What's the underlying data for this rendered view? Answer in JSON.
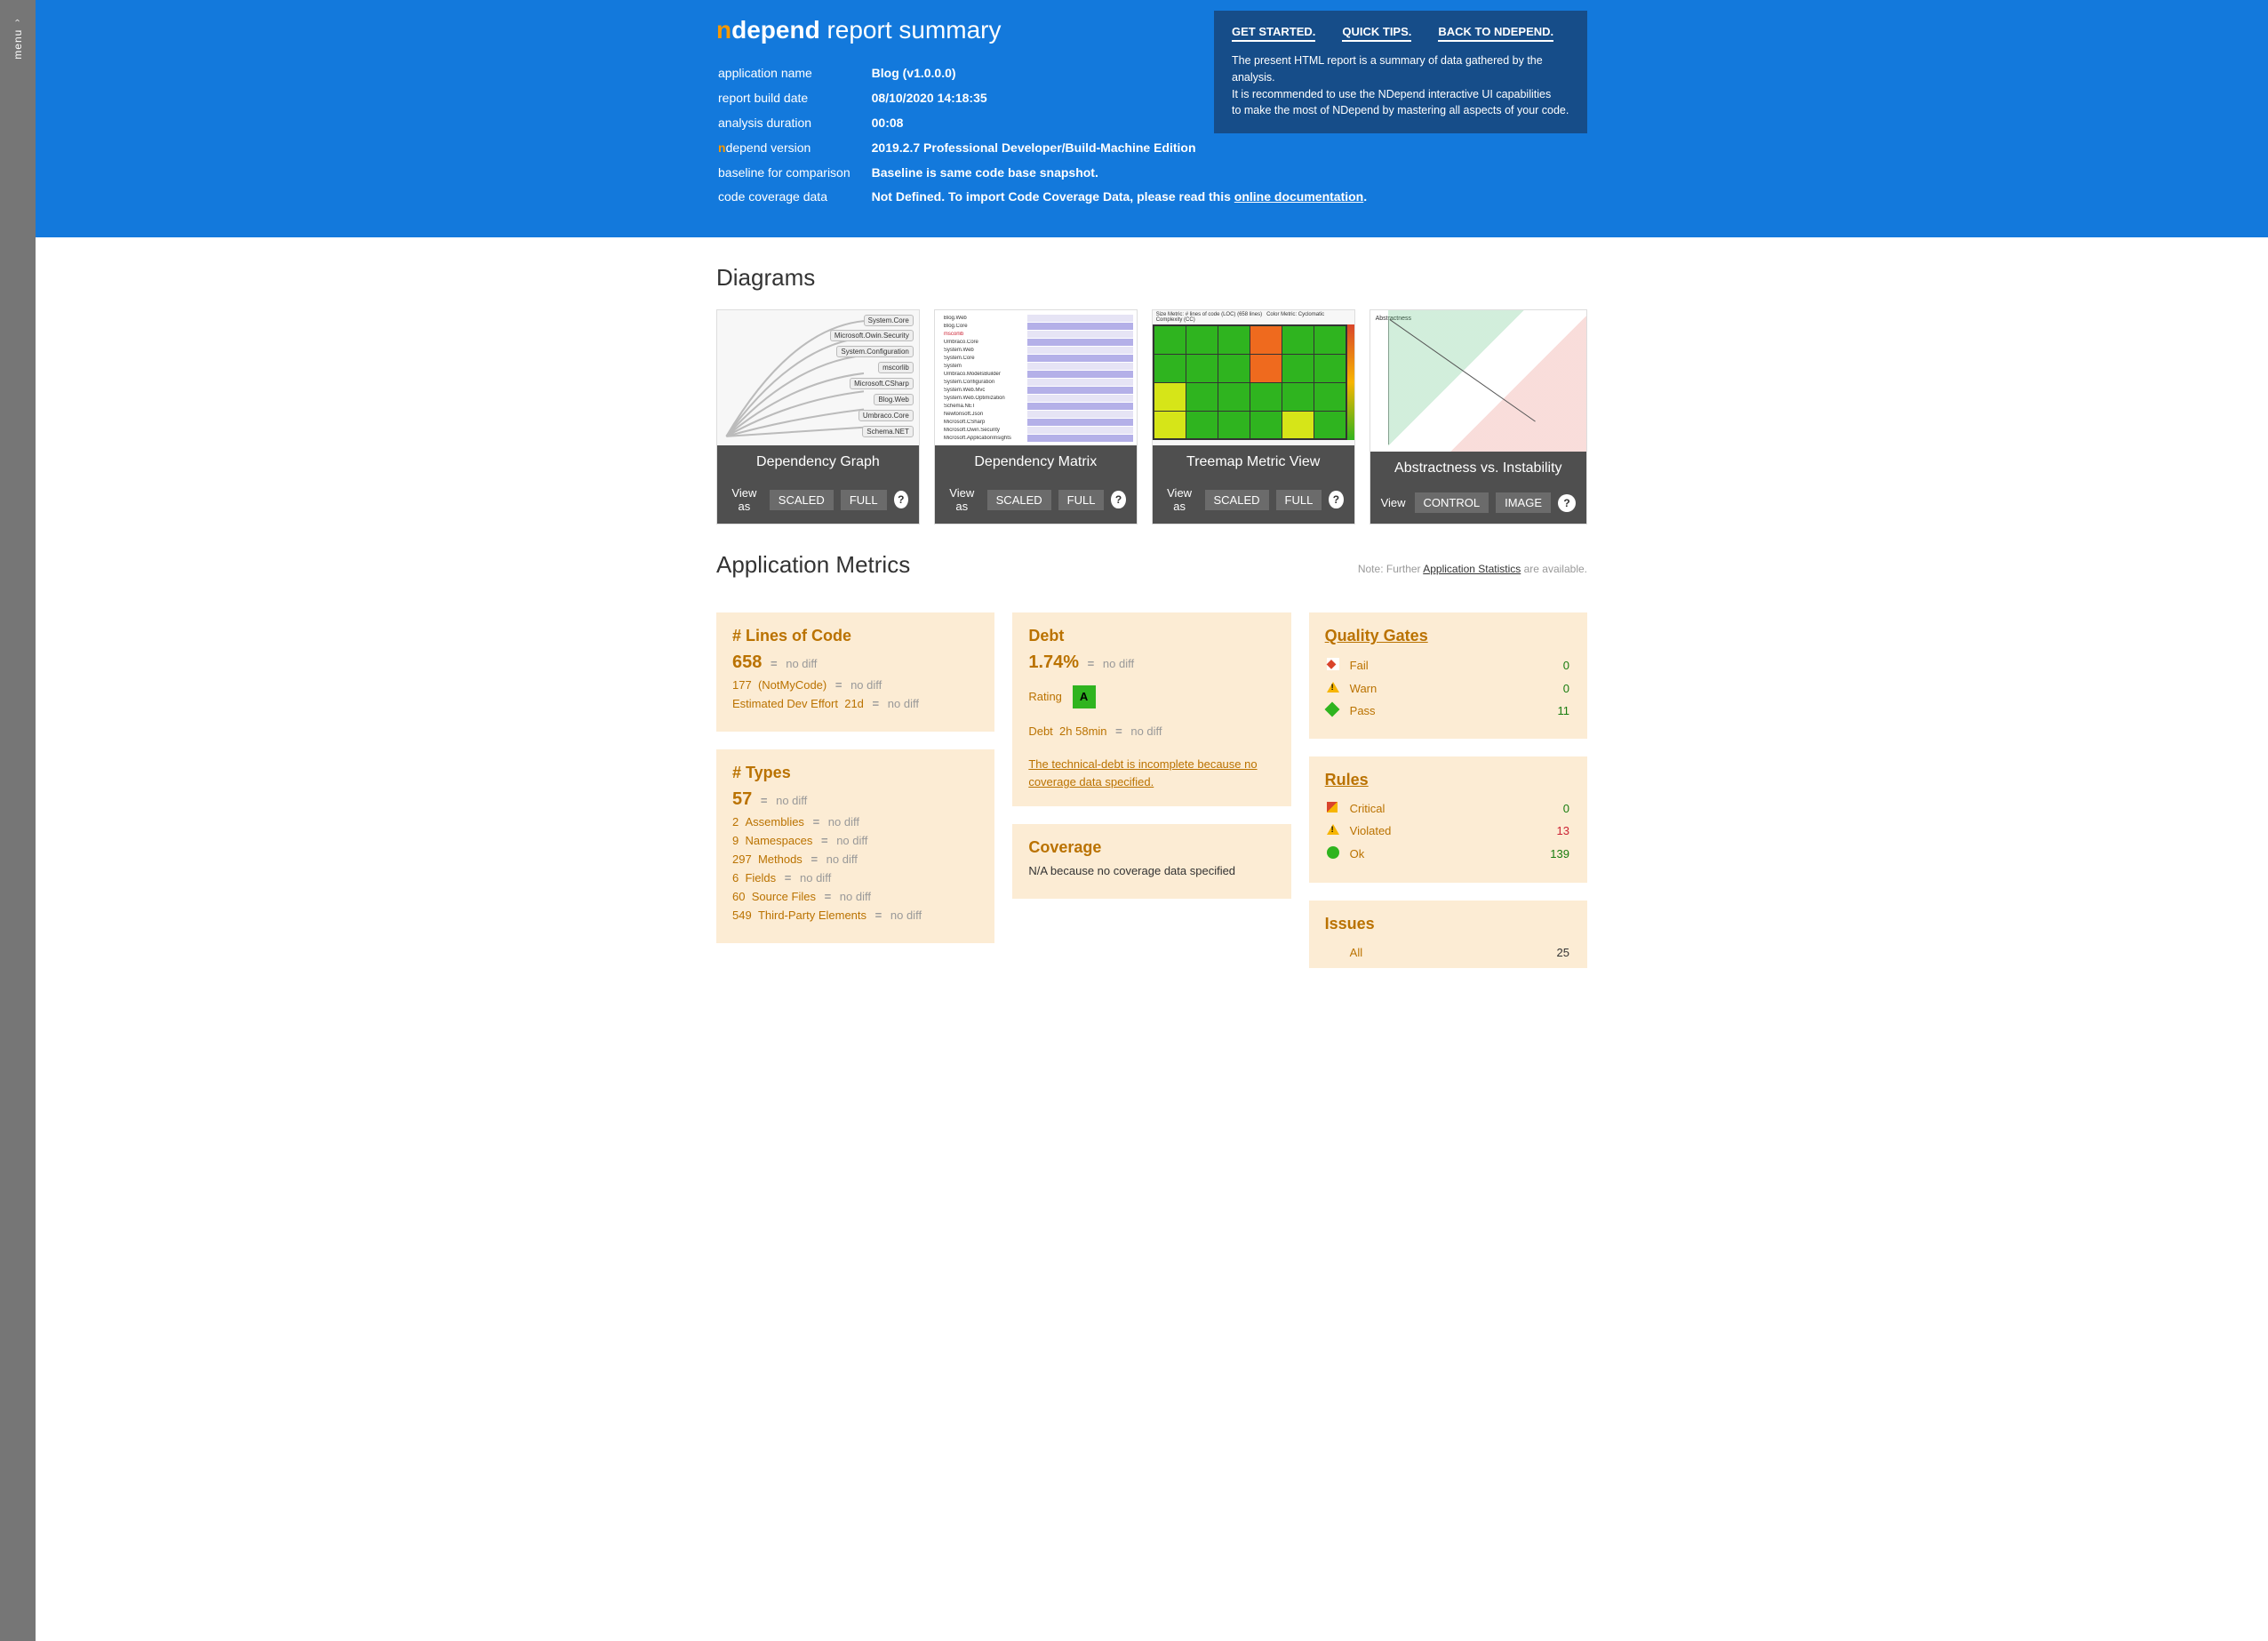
{
  "menu": {
    "label": "menu"
  },
  "header": {
    "title_n": "n",
    "title_dep": "depend",
    "title_rest": " report summary",
    "tips": {
      "links": [
        "GET STARTED.",
        "QUICK TIPS.",
        "BACK TO NDEPEND."
      ],
      "text1": "The present HTML report is a summary of data gathered by the analysis.",
      "text2": "It is recommended to use the NDepend interactive UI capabilities",
      "text3": "to make the most of NDepend by mastering all aspects of your code."
    },
    "info": {
      "app_label": "application name",
      "app_value": "Blog (v1.0.0.0)",
      "date_label": "report build date",
      "date_value": "08/10/2020 14:18:35",
      "dur_label": "analysis duration",
      "dur_value": "00:08",
      "ver_label_n": "n",
      "ver_label_rest": "depend version",
      "ver_value": "2019.2.7   Professional Developer/Build-Machine Edition",
      "base_label": "baseline for comparison",
      "base_value": "Baseline is same code base snapshot.",
      "cov_label": "code coverage data",
      "cov_value_pre": "Not Defined. To import Code Coverage Data, please read this ",
      "cov_link": "online documentation",
      "cov_value_post": "."
    }
  },
  "sections": {
    "diagrams": "Diagrams",
    "metrics": "Application Metrics"
  },
  "diagrams": [
    {
      "title": "Dependency Graph",
      "view": "View as",
      "b1": "SCALED",
      "b2": "FULL"
    },
    {
      "title": "Dependency Matrix",
      "view": "View as",
      "b1": "SCALED",
      "b2": "FULL"
    },
    {
      "title": "Treemap Metric View",
      "view": "View as",
      "b1": "SCALED",
      "b2": "FULL"
    },
    {
      "title": "Abstractness vs. Instability",
      "view": "View",
      "b1": "CONTROL",
      "b2": "IMAGE"
    }
  ],
  "note": {
    "pre": "Note: Further ",
    "link": "Application Statistics",
    "post": " are available."
  },
  "loc": {
    "title": "# Lines of Code",
    "main": "658",
    "nodiff": "no diff",
    "r1a": "177",
    "r1b": "(NotMyCode)",
    "r2a": "Estimated Dev Effort",
    "r2b": "21d"
  },
  "types": {
    "title": "# Types",
    "main": "57",
    "nodiff": "no diff",
    "rows": [
      {
        "n": "2",
        "l": "Assemblies"
      },
      {
        "n": "9",
        "l": "Namespaces"
      },
      {
        "n": "297",
        "l": "Methods"
      },
      {
        "n": "6",
        "l": "Fields"
      },
      {
        "n": "60",
        "l": "Source Files"
      },
      {
        "n": "549",
        "l": "Third-Party Elements"
      }
    ]
  },
  "debt": {
    "title": "Debt",
    "main": "1.74%",
    "nodiff": "no diff",
    "rating_label": "Rating",
    "rating": "A",
    "r1a": "Debt",
    "r1b": "2h 58min",
    "note": "The technical-debt is incomplete because no coverage data specified."
  },
  "coverage": {
    "title": "Coverage",
    "text": "N/A because no coverage data specified"
  },
  "qg": {
    "title": "Quality Gates",
    "rows": [
      {
        "l": "Fail",
        "v": "0",
        "cls": "green",
        "ico": "fail"
      },
      {
        "l": "Warn",
        "v": "0",
        "cls": "green",
        "ico": "warn"
      },
      {
        "l": "Pass",
        "v": "11",
        "cls": "green",
        "ico": "pass"
      }
    ]
  },
  "rules": {
    "title": "Rules",
    "rows": [
      {
        "l": "Critical",
        "v": "0",
        "cls": "green",
        "ico": "crit"
      },
      {
        "l": "Violated",
        "v": "13",
        "cls": "red",
        "ico": "warn"
      },
      {
        "l": "Ok",
        "v": "139",
        "cls": "green",
        "ico": "ok"
      }
    ]
  },
  "issues": {
    "title": "Issues",
    "rows": [
      {
        "l": "All",
        "v": "25",
        "cls": "",
        "ico": ""
      }
    ]
  },
  "eq": "=",
  "help": "?"
}
